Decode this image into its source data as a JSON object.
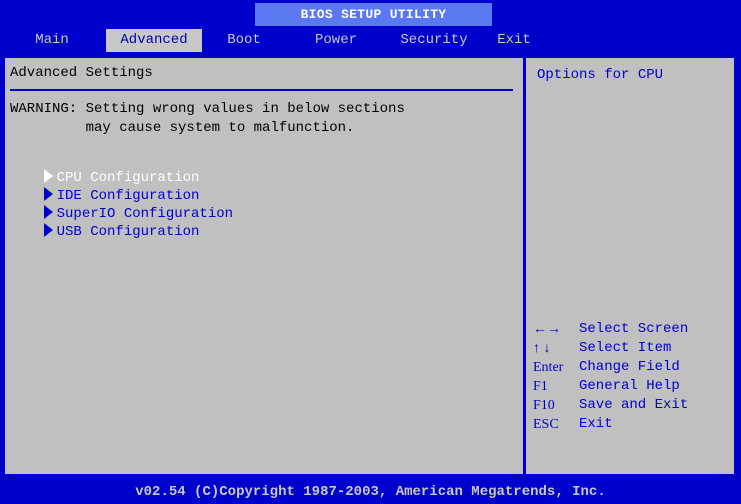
{
  "title": "BIOS SETUP UTILITY",
  "menu": {
    "tabs": [
      {
        "label": "Main"
      },
      {
        "label": "Advanced"
      },
      {
        "label": "Boot"
      },
      {
        "label": "Power"
      },
      {
        "label": "Security"
      },
      {
        "label": "Exit"
      }
    ],
    "active": "Advanced"
  },
  "main": {
    "heading": "Advanced Settings",
    "warning_line1": "WARNING: Setting wrong values in below sections",
    "warning_line2": "         may cause system to malfunction.",
    "items": [
      {
        "label": "CPU Configuration",
        "icon": "triangle-right-icon",
        "selected": true
      },
      {
        "label": "IDE Configuration",
        "icon": "triangle-right-icon",
        "selected": false
      },
      {
        "label": "SuperIO Configuration",
        "icon": "triangle-right-icon",
        "selected": false
      },
      {
        "label": "USB Configuration",
        "icon": "triangle-right-icon",
        "selected": false
      }
    ]
  },
  "help": {
    "text": "Options for CPU",
    "keys": [
      {
        "key": "←→",
        "desc": "Select Screen"
      },
      {
        "key": "↑ ↓",
        "desc": "Select Item"
      },
      {
        "key": "Enter",
        "desc": "Change Field"
      },
      {
        "key": "F1",
        "desc": "General Help"
      },
      {
        "key": "F10",
        "desc": "Save and Exit"
      },
      {
        "key": "ESC",
        "desc": "Exit"
      }
    ]
  },
  "footer": "v02.54 (C)Copyright 1987-2003, American Megatrends, Inc.",
  "colors": {
    "background": "#0000cc",
    "panel": "#c0c0c0",
    "title_highlight": "#5a78f0",
    "text_blue": "#0000cc",
    "selected_text": "#ffffff"
  }
}
